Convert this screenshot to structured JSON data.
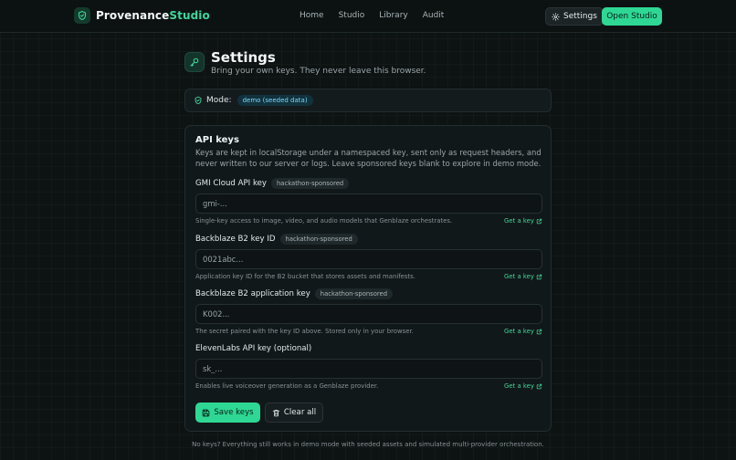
{
  "header": {
    "brand_main": "Provenance",
    "brand_accent": "Studio",
    "nav": [
      "Home",
      "Studio",
      "Library",
      "Audit"
    ],
    "settings_label": "Settings",
    "open_studio_label": "Open Studio"
  },
  "page": {
    "title": "Settings",
    "subtitle": "Bring your own keys. They never leave this browser."
  },
  "mode": {
    "label": "Mode:",
    "badge": "demo (seeded data)"
  },
  "api": {
    "title": "API keys",
    "description": "Keys are kept in localStorage under a namespaced key, sent only as request headers, and never written to our server or logs. Leave sponsored keys blank to explore in demo mode.",
    "fields": [
      {
        "label": "GMI Cloud API key",
        "tag": "hackathon-sponsored",
        "placeholder": "gmi-...",
        "help": "Single-key access to image, video, and audio models that Genblaze orchestrates.",
        "link": "Get a key"
      },
      {
        "label": "Backblaze B2 key ID",
        "tag": "hackathon-sponsored",
        "placeholder": "0021abc...",
        "help": "Application key ID for the B2 bucket that stores assets and manifests.",
        "link": "Get a key"
      },
      {
        "label": "Backblaze B2 application key",
        "tag": "hackathon-sponsored",
        "placeholder": "K002...",
        "help": "The secret paired with the key ID above. Stored only in your browser.",
        "link": "Get a key"
      },
      {
        "label": "ElevenLabs API key (optional)",
        "tag": "",
        "placeholder": "sk_...",
        "help": "Enables live voiceover generation as a Genblaze provider.",
        "link": "Get a key"
      }
    ],
    "save_label": "Save keys",
    "clear_label": "Clear all"
  },
  "footer_note": "No keys? Everything still works in demo mode with seeded assets and simulated multi-provider orchestration.",
  "colors": {
    "accent": "#2ed894",
    "background": "#0d1213",
    "card": "#111819",
    "badge_blue": "#7fd8ff"
  }
}
